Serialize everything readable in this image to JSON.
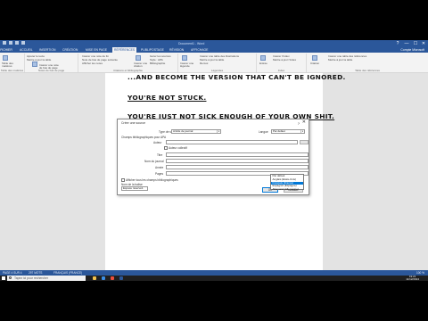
{
  "window": {
    "title": "Document1 - Word",
    "controls": [
      "?",
      "—",
      "☐",
      "✕"
    ]
  },
  "tabs": [
    {
      "label": "FICHIER"
    },
    {
      "label": "ACCUEIL"
    },
    {
      "label": "INSERTION"
    },
    {
      "label": "CRÉATION"
    },
    {
      "label": "MISE EN PAGE"
    },
    {
      "label": "RÉFÉRENCES"
    },
    {
      "label": "PUBLIPOSTAGE"
    },
    {
      "label": "RÉVISION"
    },
    {
      "label": "AFFICHAGE"
    }
  ],
  "user": "Compte Microsoft",
  "ribbon": {
    "groups": [
      {
        "caption": "Table des matières",
        "lines": [
          "Table des",
          "matières"
        ]
      },
      {
        "caption": "Notes de bas de page",
        "lines": [
          "Ajouter le texte",
          "Mettre à jour la table",
          "Insérer une note",
          "de bas de page"
        ]
      },
      {
        "caption": "Citations et bibliographie",
        "lines": [
          "Insérer une note de fin",
          "Note de bas de page suivante",
          "Afficher les notes",
          "Gérer les sources",
          "Style : APA",
          "Bibliographie",
          "Insérer une",
          "citation"
        ]
      },
      {
        "caption": "Légendes",
        "lines": [
          "Insérer une",
          "légende",
          "Insérer une table des illustrations",
          "Mettre à jour la table",
          "Renvoi"
        ]
      },
      {
        "caption": "Index",
        "lines": [
          "Entrée",
          "Insérer l'index",
          "Mettre à jour l'index"
        ]
      },
      {
        "caption": "Table des références",
        "lines": [
          "Citation",
          "Insérer une table des références",
          "Mettre à jour la table"
        ]
      }
    ]
  },
  "document": {
    "line1": "...AND BECOME THE VERSION THAT CAN'T BE IGNORED.",
    "line2": "YOU'RE NOT STUCK.",
    "line3": "YOU'RE JUST NOT SICK ENOUGH OF YOUR OWN SHIT."
  },
  "dialog": {
    "title": "Créer une source",
    "help": "?",
    "close": "✕",
    "source_type_label": "Type de source",
    "source_type_value": "Article de journal",
    "language_label": "Langue",
    "language_value": "Par défaut",
    "bib_fields_label": "Champs bibliographiques pour APA",
    "author_label": "Auteur",
    "corporate_author_label": "Auteur collectif",
    "title_label": "Titre",
    "journal_label": "Nom du journal",
    "year_label": "Année",
    "pages_label": "Pages",
    "show_all_label": "Afficher tous les champs bibliographiques",
    "tag_name_label": "Nom de la balise",
    "tag_name_value": "Espace réservé1",
    "ok_label": "OK",
    "cancel_label": "Annuler"
  },
  "language_dropdown": {
    "items": [
      "Par défaut",
      "Anglais (États-Unis)",
      "Français (France)",
      "Espagnol (Espagne)",
      "Allemand (Allemagne)"
    ],
    "highlighted_index": 2
  },
  "statusbar": {
    "page": "PAGE 4 SUR 4",
    "words": "297 MOTS",
    "language": "FRANÇAIS (FRANCE)",
    "zoom": "100 %"
  },
  "taskbar": {
    "search_placeholder": "Tapez ici pour rechercher",
    "time": "19:21",
    "date": "11/12/2024"
  },
  "colors": {
    "accent": "#2b579a",
    "selection": "#0078d7"
  }
}
